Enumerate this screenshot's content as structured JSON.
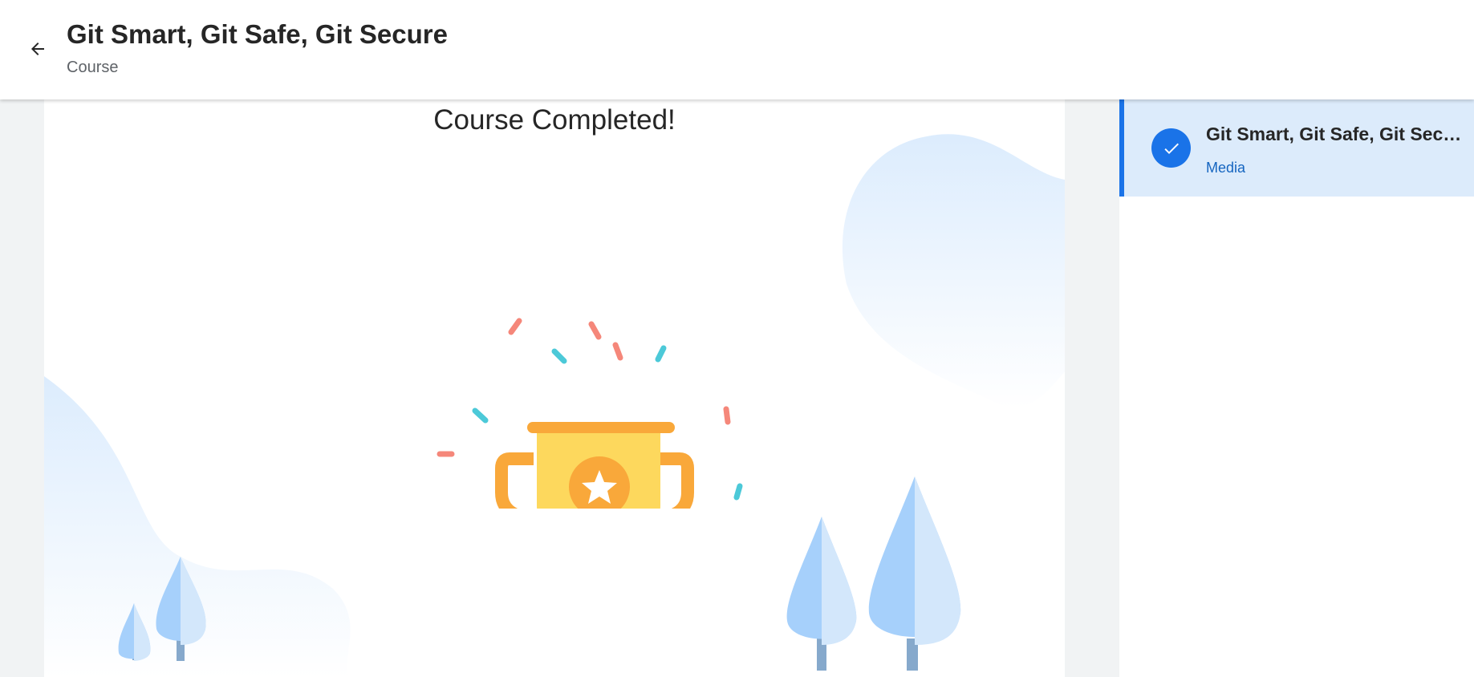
{
  "header": {
    "title": "Git Smart, Git Safe, Git Secure",
    "subtitle": "Course",
    "back_icon": "arrow-left-icon"
  },
  "main": {
    "completion_message": "Course Completed!",
    "illustration": "trophy-icon"
  },
  "sidebar": {
    "items": [
      {
        "title": "Git Smart, Git Safe, Git Secure",
        "type": "Media",
        "status": "completed",
        "status_icon": "check-icon"
      }
    ]
  },
  "colors": {
    "accent": "#1a73e8",
    "selected_bg": "#dcebfb",
    "trophy_gold": "#fdd85d",
    "trophy_orange": "#f9a83a",
    "confetti_red": "#f5877a",
    "confetti_teal": "#4cc9d8"
  }
}
